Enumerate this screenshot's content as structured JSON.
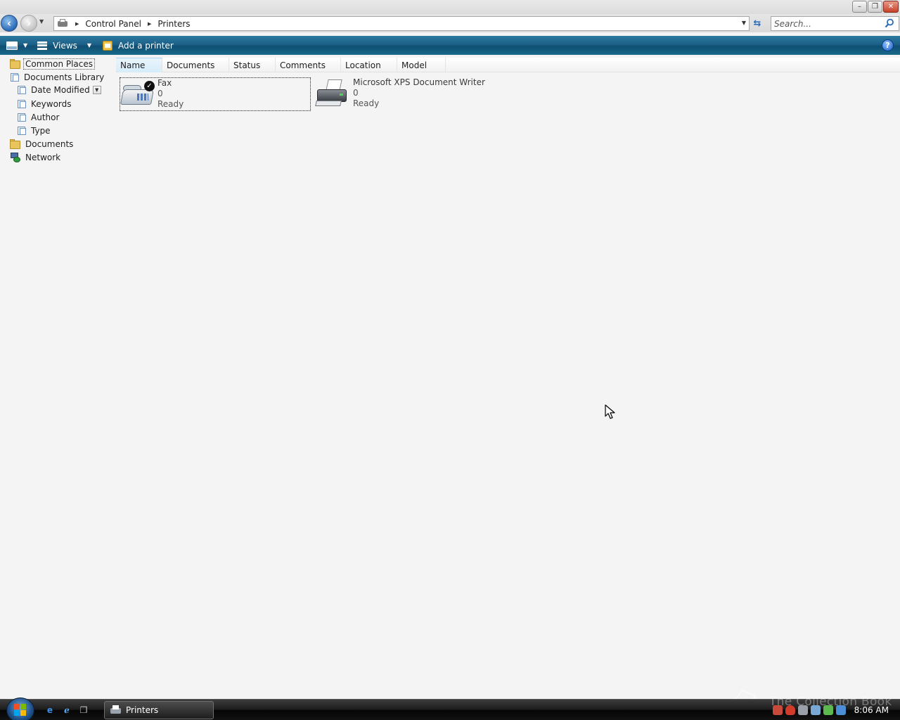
{
  "window": {
    "controls": {
      "minimize": "–",
      "restore": "❐",
      "close": "✕"
    }
  },
  "address": {
    "breadcrumbs": [
      "Control Panel",
      "Printers"
    ],
    "search_placeholder": "Search..."
  },
  "commandbar": {
    "views_label": "Views",
    "add_printer_label": "Add a printer",
    "help_label": "?"
  },
  "navpane": {
    "items": [
      {
        "label": "Common Places"
      },
      {
        "label": "Documents Library"
      },
      {
        "label": "Date Modified"
      },
      {
        "label": "Keywords"
      },
      {
        "label": "Author"
      },
      {
        "label": "Type"
      },
      {
        "label": "Documents"
      },
      {
        "label": "Network"
      }
    ]
  },
  "columns": [
    "Name",
    "Documents",
    "Status",
    "Comments",
    "Location",
    "Model"
  ],
  "printers": [
    {
      "name": "Fax",
      "documents": "0",
      "status": "Ready",
      "icon": "fax-icon"
    },
    {
      "name": "Microsoft XPS Document Writer",
      "documents": "0",
      "status": "Ready",
      "icon": "printer-icon"
    }
  ],
  "taskbar": {
    "task_label": "Printers",
    "clock": "8:06 AM",
    "watermark": "The Collection Book"
  },
  "colors": {
    "command_bar": "#1c6088",
    "background": "#f4f4f4",
    "accent": "#2a6bb8"
  }
}
